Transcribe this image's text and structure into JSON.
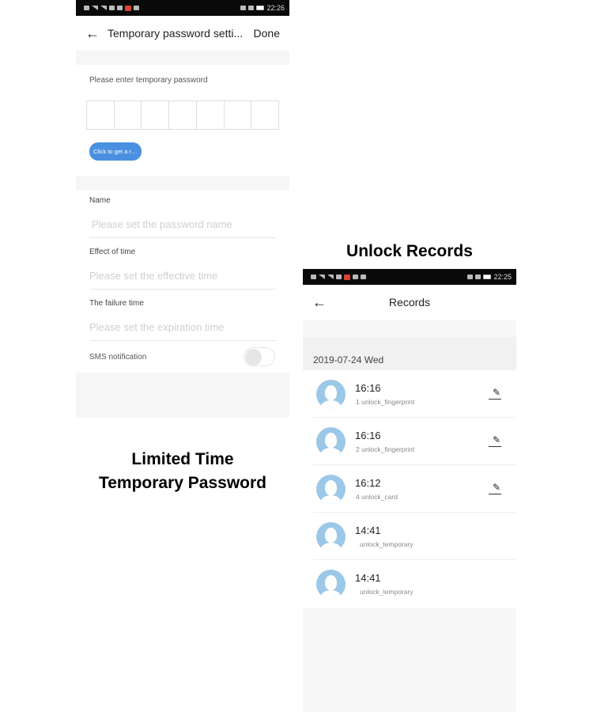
{
  "left_screen": {
    "status_bar": {
      "time": "22:26"
    },
    "nav": {
      "back_icon": "arrow-left-icon",
      "title": "Temporary password setti...",
      "done_label": "Done"
    },
    "password_prompt": "Please enter temporary password",
    "password_digits": [
      "",
      "",
      "",
      "",
      "",
      "",
      ""
    ],
    "random_button_label": "Click to get a ran...",
    "fields": [
      {
        "label": "Name",
        "placeholder": "Please set the password name"
      },
      {
        "label": "Effect of time",
        "placeholder": "Please set the effective time"
      },
      {
        "label": "The failure time",
        "placeholder": "Please set the expiration time"
      }
    ],
    "sms_notification": {
      "label": "SMS notification",
      "enabled": false
    }
  },
  "captions": {
    "left_line1": "Limited Time",
    "left_line2": "Temporary Password",
    "right": "Unlock Records"
  },
  "right_screen": {
    "status_bar": {
      "time": "22:25"
    },
    "nav": {
      "back_icon": "arrow-left-icon",
      "title": "Records"
    },
    "date_header": "2019-07-24 Wed",
    "records": [
      {
        "time": "16:16",
        "detail": "1 unlock_fingerprint",
        "editable": true
      },
      {
        "time": "16:16",
        "detail": "2 unlock_fingerprint",
        "editable": true
      },
      {
        "time": "16:12",
        "detail": "4 unlock_card",
        "editable": true
      },
      {
        "time": "14:41",
        "detail": "unlock_temporary",
        "editable": false
      },
      {
        "time": "14:41",
        "detail": "unlock_temporary",
        "editable": false
      }
    ]
  },
  "colors": {
    "accent_blue": "#4a90e2",
    "avatar_blue": "#9cc8e8"
  }
}
